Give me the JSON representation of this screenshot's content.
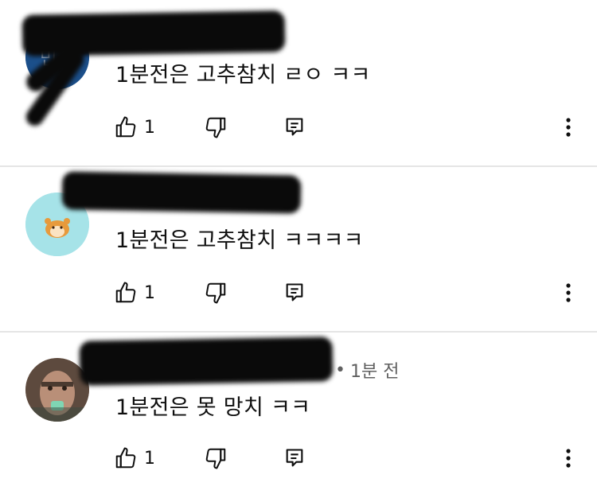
{
  "comments": [
    {
      "author": "",
      "time": "",
      "text": "1분전은 고추참치 ㄹㅇ ㅋㅋ",
      "likes": "1",
      "avatar": {
        "type": "initials",
        "initials": "민서",
        "color": "#1b4f8a"
      }
    },
    {
      "author": "",
      "time": "",
      "text": "1분전은 고추참치 ㅋㅋㅋㅋ",
      "likes": "1",
      "avatar": {
        "type": "hamster",
        "color": "#a6e3e8"
      }
    },
    {
      "author": "",
      "time": "1분 전",
      "separator": "•",
      "text": "1분전은 못 망치 ㅋㅋ",
      "likes": "1",
      "avatar": {
        "type": "photo",
        "color": "#8a6f5e"
      }
    }
  ],
  "icons": {
    "like": "thumbs-up-icon",
    "dislike": "thumbs-down-icon",
    "reply": "reply-icon",
    "more": "more-vertical-icon"
  }
}
